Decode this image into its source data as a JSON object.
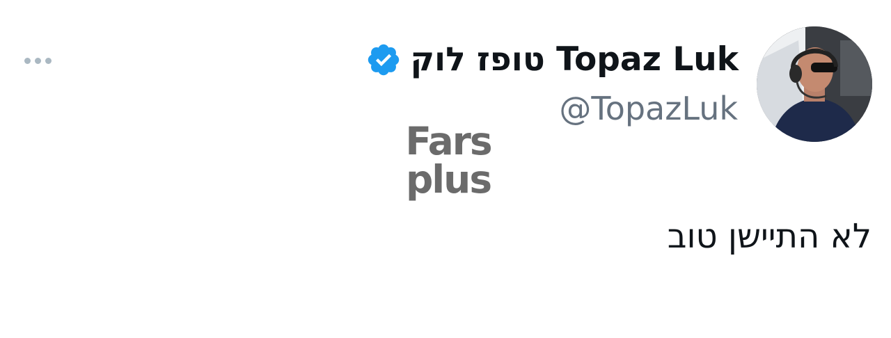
{
  "tweet": {
    "display_name": "טופז לוק Topaz Luk",
    "handle": "@TopazLuk",
    "verified": true,
    "text": "לא התיישן טוב"
  },
  "watermark": {
    "line1": "Fars",
    "line2": "plus"
  },
  "icons": {
    "verified": "verified-badge-icon",
    "more": "more-dots-icon"
  },
  "colors": {
    "verified_blue": "#1d9bf0",
    "handle_gray": "#66727f",
    "text": "#0f1419"
  }
}
